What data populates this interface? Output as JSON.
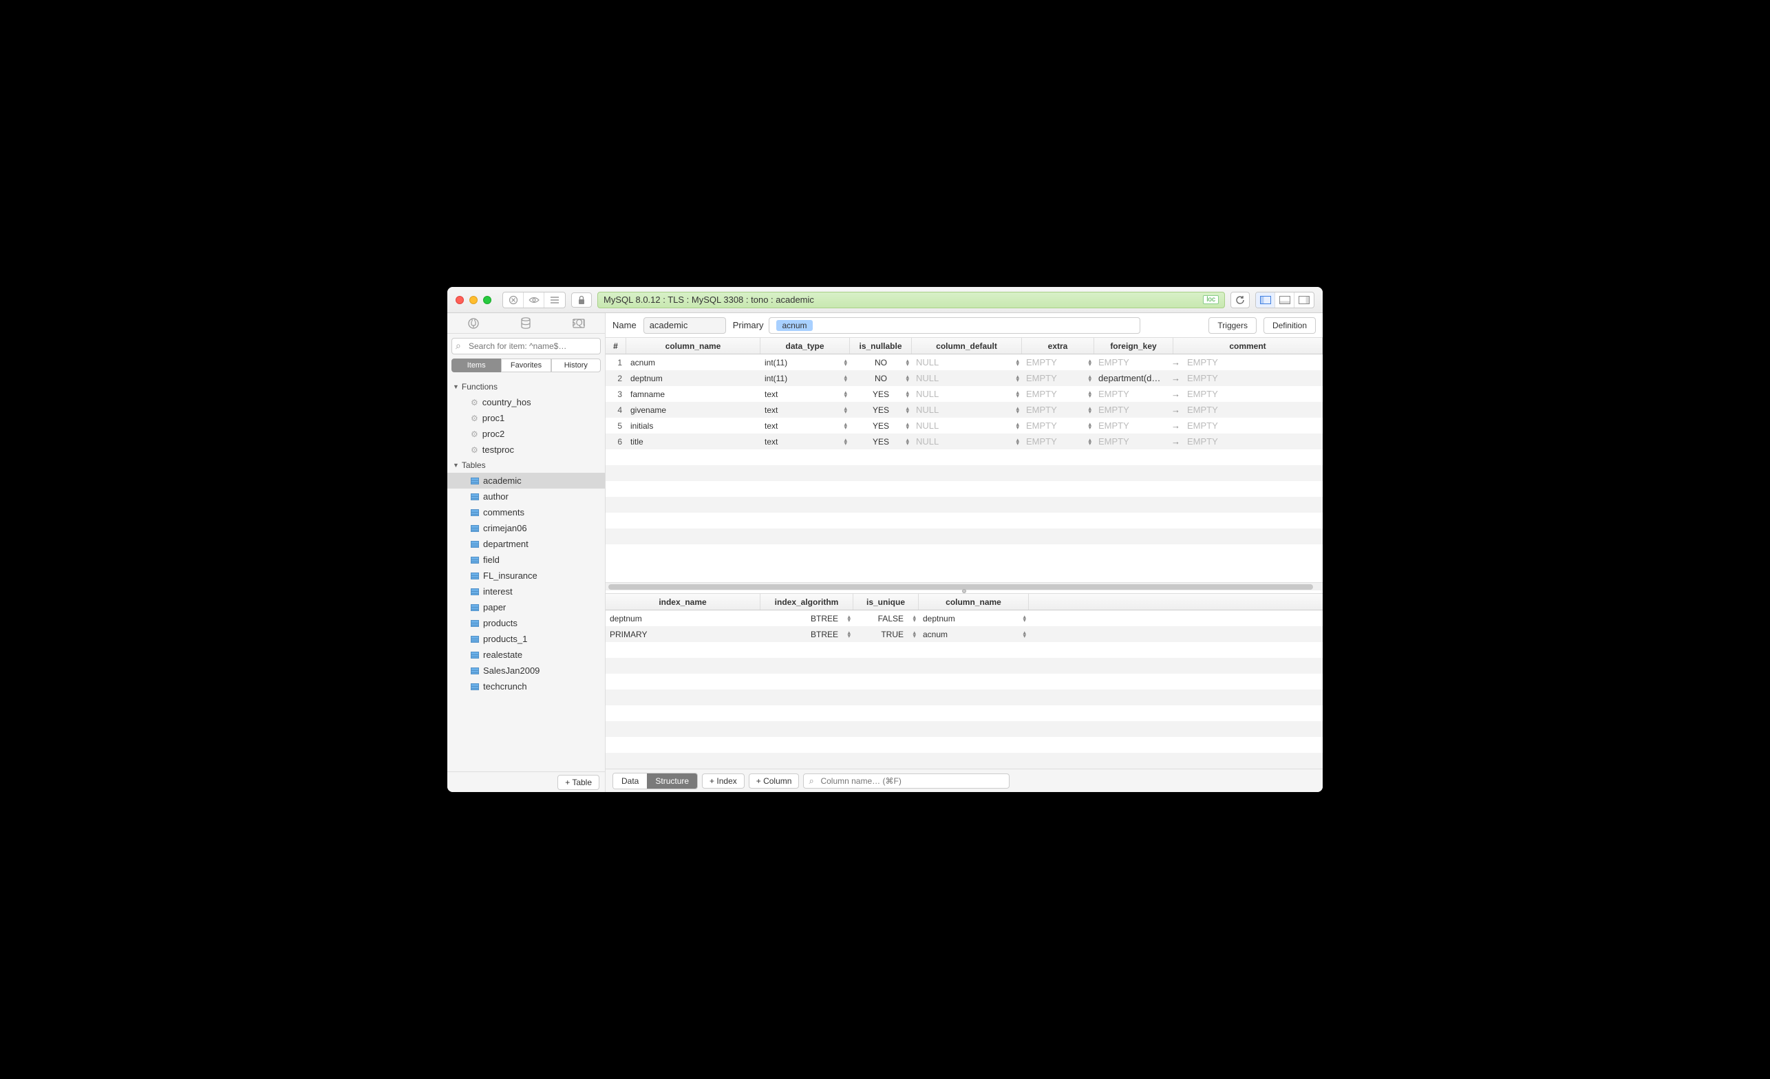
{
  "connection": "MySQL 8.0.12 : TLS : MySQL 3308 : tono : academic",
  "connection_badge": "loc",
  "sidebar": {
    "search_placeholder": "Search for item: ^name$…",
    "filters": [
      "Items",
      "Favorites",
      "History"
    ],
    "groups": [
      {
        "label": "Functions",
        "items": [
          {
            "label": "country_hos",
            "type": "fn"
          },
          {
            "label": "proc1",
            "type": "fn"
          },
          {
            "label": "proc2",
            "type": "fn"
          },
          {
            "label": "testproc",
            "type": "fn"
          }
        ]
      },
      {
        "label": "Tables",
        "items": [
          {
            "label": "academic",
            "type": "tbl",
            "selected": true
          },
          {
            "label": "author",
            "type": "tbl"
          },
          {
            "label": "comments",
            "type": "tbl"
          },
          {
            "label": "crimejan06",
            "type": "tbl"
          },
          {
            "label": "department",
            "type": "tbl"
          },
          {
            "label": "field",
            "type": "tbl"
          },
          {
            "label": "FL_insurance",
            "type": "tbl"
          },
          {
            "label": "interest",
            "type": "tbl"
          },
          {
            "label": "paper",
            "type": "tbl"
          },
          {
            "label": "products",
            "type": "tbl"
          },
          {
            "label": "products_1",
            "type": "tbl"
          },
          {
            "label": "realestate",
            "type": "tbl"
          },
          {
            "label": "SalesJan2009",
            "type": "tbl"
          },
          {
            "label": "techcrunch",
            "type": "tbl"
          }
        ]
      }
    ],
    "add_table": "+ Table"
  },
  "header": {
    "name_label": "Name",
    "name_value": "academic",
    "primary_label": "Primary",
    "primary_value": "acnum",
    "triggers": "Triggers",
    "definition": "Definition"
  },
  "columns_grid": {
    "headers": [
      "#",
      "column_name",
      "data_type",
      "is_nullable",
      "column_default",
      "extra",
      "foreign_key",
      "comment"
    ],
    "rows": [
      {
        "n": "1",
        "name": "acnum",
        "type": "int(11)",
        "null": "NO",
        "def": "NULL",
        "extra": "EMPTY",
        "fk": "EMPTY",
        "cmt": "EMPTY"
      },
      {
        "n": "2",
        "name": "deptnum",
        "type": "int(11)",
        "null": "NO",
        "def": "NULL",
        "extra": "EMPTY",
        "fk": "department(d…",
        "cmt": "EMPTY"
      },
      {
        "n": "3",
        "name": "famname",
        "type": "text",
        "null": "YES",
        "def": "NULL",
        "extra": "EMPTY",
        "fk": "EMPTY",
        "cmt": "EMPTY"
      },
      {
        "n": "4",
        "name": "givename",
        "type": "text",
        "null": "YES",
        "def": "NULL",
        "extra": "EMPTY",
        "fk": "EMPTY",
        "cmt": "EMPTY"
      },
      {
        "n": "5",
        "name": "initials",
        "type": "text",
        "null": "YES",
        "def": "NULL",
        "extra": "EMPTY",
        "fk": "EMPTY",
        "cmt": "EMPTY"
      },
      {
        "n": "6",
        "name": "title",
        "type": "text",
        "null": "YES",
        "def": "NULL",
        "extra": "EMPTY",
        "fk": "EMPTY",
        "cmt": "EMPTY"
      }
    ]
  },
  "index_grid": {
    "headers": [
      "index_name",
      "index_algorithm",
      "is_unique",
      "column_name"
    ],
    "rows": [
      {
        "name": "deptnum",
        "alg": "BTREE",
        "uniq": "FALSE",
        "col": "deptnum"
      },
      {
        "name": "PRIMARY",
        "alg": "BTREE",
        "uniq": "TRUE",
        "col": "acnum"
      }
    ]
  },
  "bottom": {
    "data": "Data",
    "structure": "Structure",
    "add_index": "+ Index",
    "add_column": "+ Column",
    "col_search": "Column name… (⌘F)"
  }
}
